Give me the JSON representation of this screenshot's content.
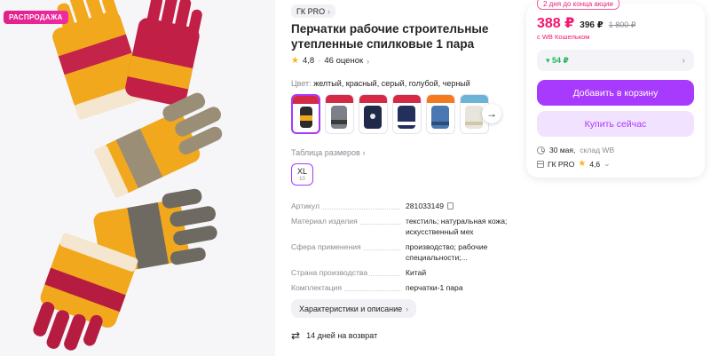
{
  "gallery": {
    "sale_badge": "РАСПРОДАЖА"
  },
  "product": {
    "brand": "ГК PRO",
    "title": "Перчатки рабочие строительные утепленные спилковые 1 пара",
    "rating": "4,8",
    "reviews": "46 оценок",
    "color_label": "Цвет:",
    "color_value": "желтый, красный, серый, голубой, черный",
    "size_table_label": "Таблица размеров",
    "size": {
      "label": "XL",
      "number": "10"
    },
    "specs": [
      {
        "key": "Артикул",
        "value": "281033149"
      },
      {
        "key": "Материал изделия",
        "value": "текстиль; натуральная кожа; искусственный мех"
      },
      {
        "key": "Сфера применения",
        "value": "производство; рабочие специальности;..."
      },
      {
        "key": "Страна производства",
        "value": "Китай"
      },
      {
        "key": "Комплектация",
        "value": "перчатки-1 пара"
      }
    ],
    "characteristics_button": "Характеристики и описание",
    "return_text": "14 дней на возврат"
  },
  "buy_card": {
    "promo": "2 дня до конца акции",
    "price": "388 ₽",
    "price_mid": "396 ₽",
    "price_old": "1 800 ₽",
    "wallet_note": "с WB Кошельком",
    "cashback": "54 ₽",
    "add_to_cart": "Добавить в корзину",
    "buy_now": "Купить сейчас",
    "delivery_date": "30 мая,",
    "delivery_place": "склад WB",
    "seller_name": "ГК PRO",
    "seller_rating": "4,6"
  },
  "colors": {
    "accent": "#a73afd",
    "price": "#f5156e",
    "cashback": "#1cb65a",
    "sale_badge": "#e0218a",
    "star": "#ffb21e"
  }
}
